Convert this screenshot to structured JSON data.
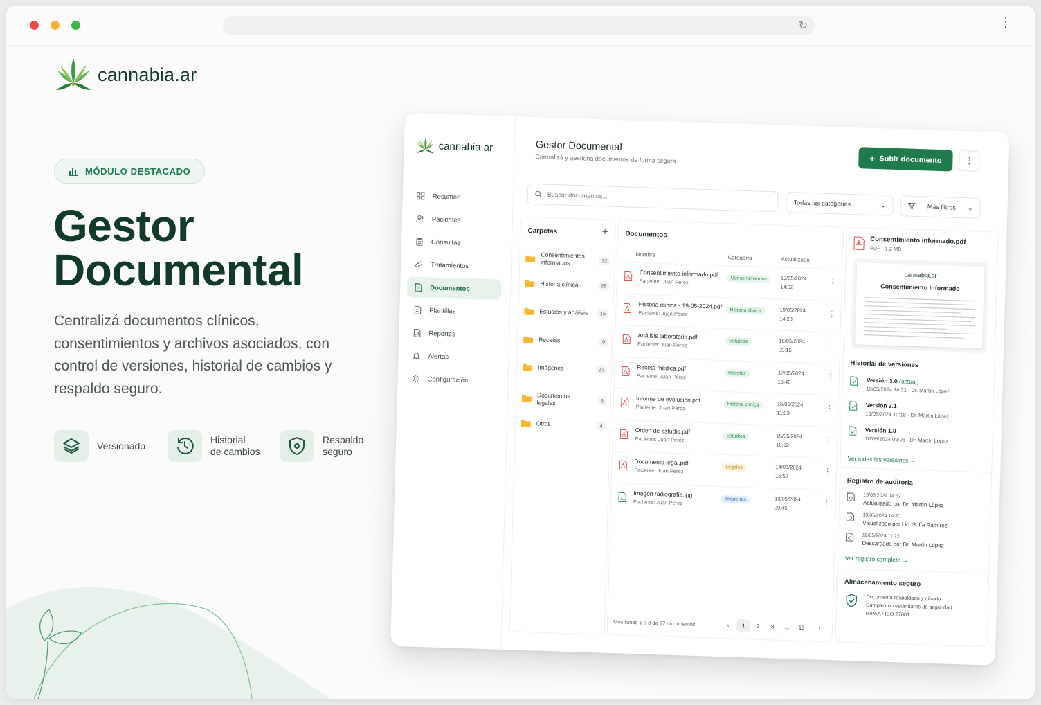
{
  "hero": {
    "brand": "cannabia.ar",
    "badge": "MÓDULO DESTACADO",
    "title_line1": "Gestor",
    "title_line2": "Documental",
    "description": "Centralizá documentos clínicos, consentimientos y archivos asociados, con control de versiones, historial de cambios y respaldo seguro.",
    "features": [
      {
        "label_line1": "Versionado",
        "label_line2": ""
      },
      {
        "label_line1": "Historial",
        "label_line2": "de cambios"
      },
      {
        "label_line1": "Respaldo",
        "label_line2": "seguro"
      }
    ]
  },
  "app": {
    "brand": "cannabia.ar",
    "nav": [
      {
        "label": "Resumen",
        "icon": "grid-icon"
      },
      {
        "label": "Pacientes",
        "icon": "users-icon"
      },
      {
        "label": "Consultas",
        "icon": "clipboard-icon"
      },
      {
        "label": "Tratamientos",
        "icon": "pill-icon"
      },
      {
        "label": "Documentos",
        "icon": "document-icon",
        "active": true
      },
      {
        "label": "Plantillas",
        "icon": "template-icon"
      },
      {
        "label": "Reportes",
        "icon": "report-icon"
      },
      {
        "label": "Alertas",
        "icon": "bell-icon"
      },
      {
        "label": "Configuración",
        "icon": "gear-icon"
      }
    ],
    "header": {
      "title": "Gestor Documental",
      "subtitle": "Centralizá y gestioná documentos de forma segura.",
      "upload_label": "Subir documento"
    },
    "search": {
      "placeholder": "Buscar documentos..."
    },
    "filters": {
      "category": "Todas las categorías",
      "more": "Más filtros"
    },
    "folders": {
      "title": "Carpetas",
      "items": [
        {
          "name": "Consentimientos informados",
          "count": "12"
        },
        {
          "name": "Historia clínica",
          "count": "28"
        },
        {
          "name": "Estudios y análisis",
          "count": "15"
        },
        {
          "name": "Recetas",
          "count": "9"
        },
        {
          "name": "Imágenes",
          "count": "23"
        },
        {
          "name": "Documentos legales",
          "count": "6"
        },
        {
          "name": "Otros",
          "count": "4"
        }
      ]
    },
    "documents": {
      "title": "Documentos",
      "columns": {
        "name": "Nombre",
        "category": "Categoría",
        "updated": "Actualizado"
      },
      "rows": [
        {
          "name": "Consentimiento informado.pdf",
          "patient": "Paciente: Juan Pérez",
          "category": "Consentimientos",
          "date": "19/05/2024",
          "time": "14:32",
          "kind": "pdf"
        },
        {
          "name": "Historia clínica - 19-05-2024.pdf",
          "patient": "Paciente: Juan Pérez",
          "category": "Historia clínica",
          "date": "19/05/2024",
          "time": "14:28",
          "kind": "pdf"
        },
        {
          "name": "Análisis laboratorio.pdf",
          "patient": "Paciente: Juan Pérez",
          "category": "Estudios",
          "date": "18/05/2024",
          "time": "09:15",
          "kind": "pdf"
        },
        {
          "name": "Receta médica.pdf",
          "patient": "Paciente: Juan Pérez",
          "category": "Recetas",
          "date": "17/05/2024",
          "time": "16:40",
          "kind": "pdf"
        },
        {
          "name": "Informe de evolución.pdf",
          "patient": "Paciente: Juan Pérez",
          "category": "Historia clínica",
          "date": "16/05/2024",
          "time": "11:03",
          "kind": "pdf"
        },
        {
          "name": "Orden de estudio.pdf",
          "patient": "Paciente: Juan Pérez",
          "category": "Estudios",
          "date": "15/05/2024",
          "time": "10:22",
          "kind": "pdf"
        },
        {
          "name": "Documento legal.pdf",
          "patient": "Paciente: Juan Pérez",
          "category": "Legales",
          "date": "14/05/2024",
          "time": "15:50",
          "kind": "pdf"
        },
        {
          "name": "Imagen radiografía.jpg",
          "patient": "Paciente: Juan Pérez",
          "category": "Imágenes",
          "date": "13/05/2024",
          "time": "09:45",
          "kind": "img"
        }
      ],
      "pagination": {
        "summary": "Mostrando 1 a 8 de 97 documentos",
        "pages": [
          "1",
          "2",
          "3",
          "...",
          "13"
        ]
      }
    },
    "preview": {
      "file_name": "Consentimiento informado.pdf",
      "file_meta": "PDF · 1.2 MB",
      "doc_brand": "cannabia.ar",
      "doc_title": "Consentimiento Informado",
      "versions_title": "Historial de versiones",
      "versions": [
        {
          "label": "Versión 3.0",
          "current": "(actual)",
          "meta": "19/05/2024 14:32 · Dr. Martín López"
        },
        {
          "label": "Versión 2.1",
          "current": "",
          "meta": "15/05/2024 10:18 · Dr. Martín López"
        },
        {
          "label": "Versión 1.0",
          "current": "",
          "meta": "10/05/2024 09:05 · Dr. Martín López"
        }
      ],
      "versions_link": "Ver todas las versiones",
      "audit_title": "Registro de auditoría",
      "audit": [
        {
          "time": "19/05/2024 14:32",
          "text": "Actualizado por Dr. Martín López"
        },
        {
          "time": "19/05/2024 14:30",
          "text": "Visualizado por Lic. Sofía Ramírez"
        },
        {
          "time": "18/05/2024 11:22",
          "text": "Descargado por Dr. Martín López"
        }
      ],
      "audit_link": "Ver registro completo",
      "storage_title": "Almacenamiento seguro",
      "storage_line1": "Documento respaldado y cifrado",
      "storage_line2": "Cumple con estándares de seguridad",
      "storage_line3": "HIPAA / ISO 27001"
    }
  },
  "colors": {
    "accent": "#1f7a4c",
    "dark_green": "#113a28",
    "pdf_red": "#d9534f",
    "folder_yellow": "#f5b82e"
  }
}
